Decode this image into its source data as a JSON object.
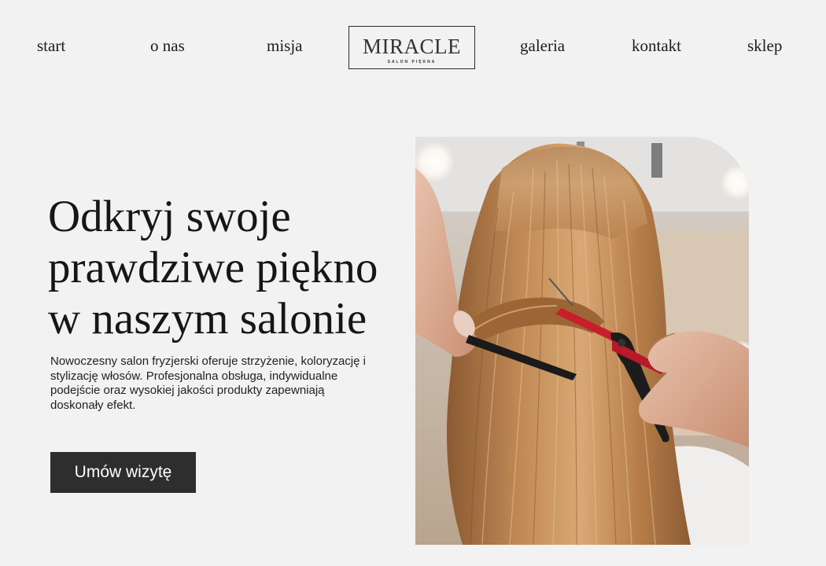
{
  "nav": {
    "items": [
      {
        "label": "start"
      },
      {
        "label": "o nas"
      },
      {
        "label": "misja"
      },
      {
        "label": "galeria"
      },
      {
        "label": "kontakt"
      },
      {
        "label": "sklep"
      }
    ],
    "logo": {
      "name": "MIRACLE",
      "tagline": "SALON PIĘKNA"
    }
  },
  "hero": {
    "title_lines": [
      "Odkryj swoje",
      "prawdziwe piękno",
      "w naszym salonie"
    ],
    "description": "Nowoczesny salon fryzjerski oferuje strzyżenie, koloryzację i stylizację włosów. Profesjonalna obsługa, indywidualne podejście oraz wysokiej jakości produkty zapewniają doskonały efekt.",
    "cta_label": "Umów wizytę",
    "image_subject": "hairdresser-cutting-hair-photo"
  },
  "colors": {
    "background": "#f3f2f2",
    "text": "#1c1c1c",
    "button_bg": "#2e2e2e",
    "button_text": "#ffffff",
    "scissors_accent": "#c81e2c"
  }
}
